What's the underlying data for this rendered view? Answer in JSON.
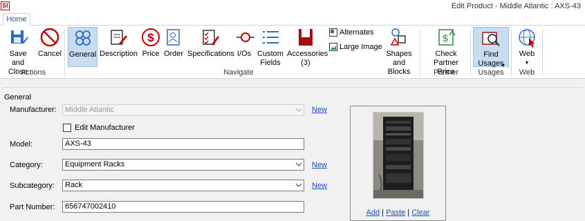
{
  "window": {
    "title": "Edit Product - Middle Atlantic : AXS-43",
    "logo": "SI"
  },
  "tabs": [
    {
      "label": "Home"
    }
  ],
  "ribbon": {
    "actions": {
      "save_close": "Save and\nClose",
      "cancel": "Cancel",
      "group": "Actions"
    },
    "navigate": {
      "general": "General",
      "description": "Description",
      "price": "Price",
      "order": "Order",
      "specifications": "Specifications",
      "ios": "I/Os",
      "custom_fields": "Custom\nFields",
      "accessories": "Accessories\n(3)",
      "alternates": "Alternates",
      "large_image": "Large Image",
      "shapes_blocks": "Shapes\nand Blocks",
      "group": "Navigate"
    },
    "partner": {
      "check_price": "Check\nPartner Price",
      "group": "Partner"
    },
    "usages": {
      "find_usages": "Find\nUsages",
      "group": "Usages"
    },
    "web": {
      "web": "Web",
      "group": "Web"
    }
  },
  "form": {
    "section": "General",
    "manufacturer": {
      "label": "Manufacturer:",
      "value": "Middle Atlantic",
      "new_link": "New"
    },
    "edit_manufacturer": {
      "label": "Edit Manufacturer",
      "checked": false
    },
    "model": {
      "label": "Model:",
      "value": "AXS-43"
    },
    "category": {
      "label": "Category:",
      "value": "Equipment Racks",
      "new_link": "New"
    },
    "subcategory": {
      "label": "Subcategory:",
      "value": "Rack",
      "new_link": "New"
    },
    "part_number": {
      "label": "Part Number:",
      "value": "656747002410"
    }
  },
  "image": {
    "add": "Add",
    "paste": "Paste",
    "clear": "Clear",
    "sep": "|"
  },
  "icons": {
    "save": "floppy-disk-icon",
    "cancel": "cancel-icon",
    "general": "general-circles-icon",
    "description": "description-icon",
    "price": "dollar-icon",
    "order": "order-icon",
    "specifications": "checklist-icon",
    "ios": "io-connector-icon",
    "custom_fields": "list-icon",
    "accessories": "accessories-icon",
    "alternates": "alternates-icon",
    "large_image": "image-icon",
    "shapes": "shapes-icon",
    "partner_price": "partner-price-icon",
    "find_usages": "find-usages-icon",
    "web": "globe-icon"
  },
  "colors": {
    "accent": "#2b579a",
    "selected": "#c7ddf2",
    "link": "#1a50b8",
    "brand": "#c00000"
  }
}
